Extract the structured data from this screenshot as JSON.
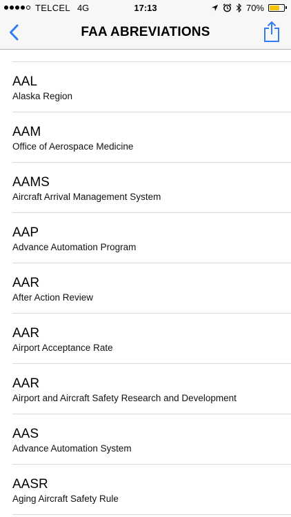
{
  "status_bar": {
    "carrier": "TELCEL",
    "network": "4G",
    "time": "17:13",
    "battery_percent": "70%",
    "battery_level": 0.7,
    "battery_color": "#f5c400"
  },
  "nav": {
    "title": "FAA ABREVIATIONS",
    "back_icon": "chevron-left-icon",
    "share_icon": "share-icon",
    "accent_color": "#2f7cf6"
  },
  "list": {
    "items": [
      {
        "abbr": "",
        "desc": ""
      },
      {
        "abbr": "AAL",
        "desc": "Alaska Region"
      },
      {
        "abbr": "AAM",
        "desc": "Office of Aerospace Medicine"
      },
      {
        "abbr": "AAMS",
        "desc": "Aircraft Arrival Management System"
      },
      {
        "abbr": "AAP",
        "desc": "Advance Automation Program"
      },
      {
        "abbr": "AAR",
        "desc": "After Action Review"
      },
      {
        "abbr": "AAR",
        "desc": "Airport Acceptance Rate"
      },
      {
        "abbr": "AAR",
        "desc": "Airport and Aircraft Safety Research and Development"
      },
      {
        "abbr": "AAS",
        "desc": "Advance Automation System"
      },
      {
        "abbr": "AASR",
        "desc": "Aging Aircraft Safety Rule"
      }
    ]
  }
}
